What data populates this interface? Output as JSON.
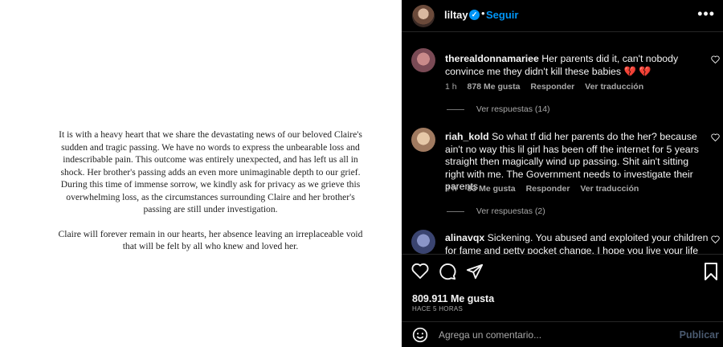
{
  "statement": {
    "paragraph1": "It is with a heavy heart that we share the devastating news of our beloved Claire's sudden and tragic passing. We have no words to express the unbearable loss and indescribable pain. This outcome was entirely unexpected, and has left us all in shock. Her brother's passing adds an even more unimaginable depth to our grief. During this time of immense sorrow, we kindly ask for privacy as we grieve this overwhelming loss, as the circumstances surrounding Claire and her brother's passing are still under investigation.",
    "paragraph2": "Claire will forever remain in our hearts, her absence leaving an irreplaceable void that will be felt by all who knew and loved her."
  },
  "header": {
    "username": "liltay",
    "verified_mark": "✓",
    "separator": "•",
    "follow_label": "Seguir",
    "more": "•••"
  },
  "comments": [
    {
      "username": "therealdonnamariee",
      "text": "Her parents did it, can't nobody convince me they didn't kill these babies 💔 💔",
      "time": "1 h",
      "likes": "878 Me gusta",
      "reply": "Responder",
      "translate": "Ver traducción",
      "view_replies": "Ver respuestas (14)"
    },
    {
      "username": "riah_kold",
      "text": "So what tf did her parents do the her? because ain't no way this lil girl has been off the internet for 5 years straight then magically wind up passing. Shit ain't sitting right with me. The Government needs to investigate their parents",
      "time": "2 h",
      "likes": "83 Me gusta",
      "reply": "Responder",
      "translate": "Ver traducción",
      "view_replies": "Ver respuestas (2)"
    },
    {
      "username": "alinavqx",
      "text": "Sickening. You abused and exploited your children for fame and petty pocket change. I hope you live your life with"
    }
  ],
  "post": {
    "likes": "809.911 Me gusta",
    "time": "HACE 5 HORAS"
  },
  "composer": {
    "placeholder": "Agrega un comentario...",
    "publish": "Publicar"
  },
  "colors": {
    "accent": "#0095f6",
    "background": "#000000",
    "muted": "#a8a8a8",
    "heart_red": "#e0245e"
  }
}
